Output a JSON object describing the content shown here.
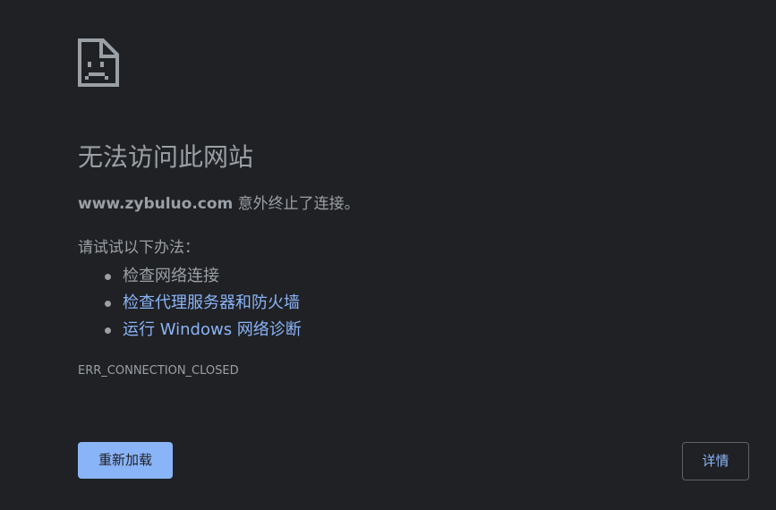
{
  "icon": "sad-page-icon",
  "title": "无法访问此网站",
  "summary": {
    "host": "www.zybuluo.com",
    "message": " 意外终止了连接。"
  },
  "suggestions": {
    "intro": "请试试以下办法：",
    "items": [
      {
        "label": "检查网络连接",
        "link": false
      },
      {
        "label": "检查代理服务器和防火墙",
        "link": true
      },
      {
        "label": "运行 Windows 网络诊断",
        "link": true
      }
    ]
  },
  "error_code": "ERR_CONNECTION_CLOSED",
  "buttons": {
    "reload": "重新加载",
    "details": "详情"
  },
  "colors": {
    "background": "#202124",
    "text": "#9aa0a6",
    "link": "#8ab4f8",
    "primary_button": "#8ab4f8",
    "border": "#5f6368"
  }
}
